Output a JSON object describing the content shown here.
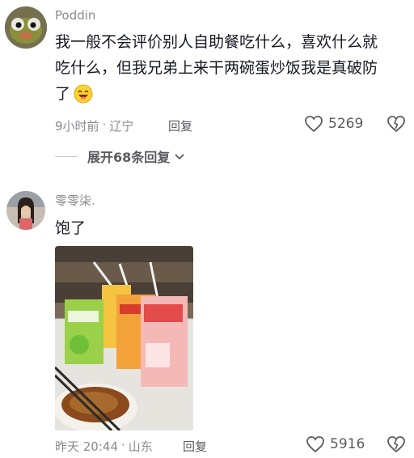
{
  "comments": [
    {
      "username": "Poddin",
      "text_line1": "我一般不会评价别人自助餐吃什么，喜欢什么就",
      "text_line2": "吃什么，但我兄弟上来干两碗蛋炒饭我是真破防",
      "text_line3": "了",
      "emoji": "laugh-emoji",
      "time": "9小时前",
      "location": "辽宁",
      "reply_label": "回复",
      "likes": "5269"
    },
    {
      "username": "零零柒.",
      "text": "饱了",
      "image_alt": "juice boxes and noodles photo",
      "time": "昨天 20:44",
      "location": "山东",
      "reply_label": "回复",
      "likes": "5916"
    }
  ],
  "expand_replies": "展开68条回复",
  "separator": "·",
  "colors": {
    "text": "#161823",
    "meta": "#8a8b91"
  }
}
